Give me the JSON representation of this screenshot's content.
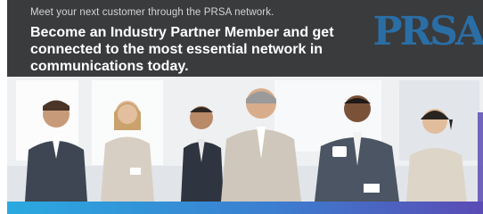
{
  "banner": {
    "tagline": "Meet your next customer through the PRSA network.",
    "headline": "Become an Industry Partner Member and get connected to the most essential network in communications today.",
    "logo_text": "PRSA",
    "colors": {
      "header_bg": "#3a3b3d",
      "logo": "#2a6ea6",
      "bar_start": "#2aa9e0",
      "bar_end": "#5a4bb5"
    }
  }
}
